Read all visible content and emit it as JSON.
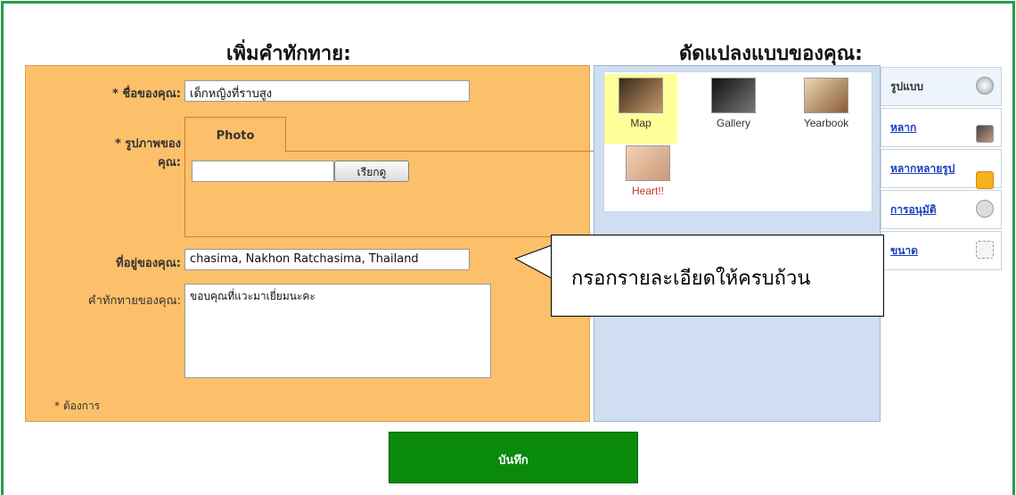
{
  "headings": {
    "add_greeting": "เพิ่มคำทักทาย:",
    "customize": "ดัดแปลงแบบของคุณ:"
  },
  "form": {
    "name_label": "* ชื่อของคุณ:",
    "name_value": "เด็กหญิงที่ราบสูง",
    "photo_label_line1": "* รูปภาพของ",
    "photo_label_line2": "คุณ:",
    "photo_tab": "Photo",
    "browse_button": "เรียกดู",
    "address_label": "ที่อยู่ของคุณ:",
    "address_value": "chasima, Nakhon Ratchasima, Thailand",
    "greeting_label": "คำทักทายของคุณ:",
    "greeting_value": "ขอบคุณที่แวะมาเยี่ยมนะคะ",
    "required_note": "* ต้องการ"
  },
  "styles": {
    "options": [
      {
        "name": "Map",
        "selected": true
      },
      {
        "name": "Gallery",
        "selected": false
      },
      {
        "name": "Yearbook",
        "selected": false
      },
      {
        "name": "Heart!!",
        "selected": false
      }
    ]
  },
  "nav": {
    "items": [
      {
        "label": "รูปแบบ",
        "icon": "globe-icon"
      },
      {
        "label": "หลาก",
        "icon": "photo-icon"
      },
      {
        "label": "หลากหลายรูป",
        "icon": "star-icon"
      },
      {
        "label": "การอนุมัติ",
        "icon": "gear-icon"
      },
      {
        "label": "ขนาด",
        "icon": "resize-icon"
      }
    ]
  },
  "callout": {
    "text": "กรอกรายละเอียดให้ครบถ้วน"
  },
  "save_button": "บันทึก",
  "colors": {
    "form_bg": "#fcc06a",
    "customize_bg": "#cfdff1",
    "save_bg": "#0a8a0a",
    "frame_border": "#2a9a4a",
    "link": "#1a3fbf"
  }
}
